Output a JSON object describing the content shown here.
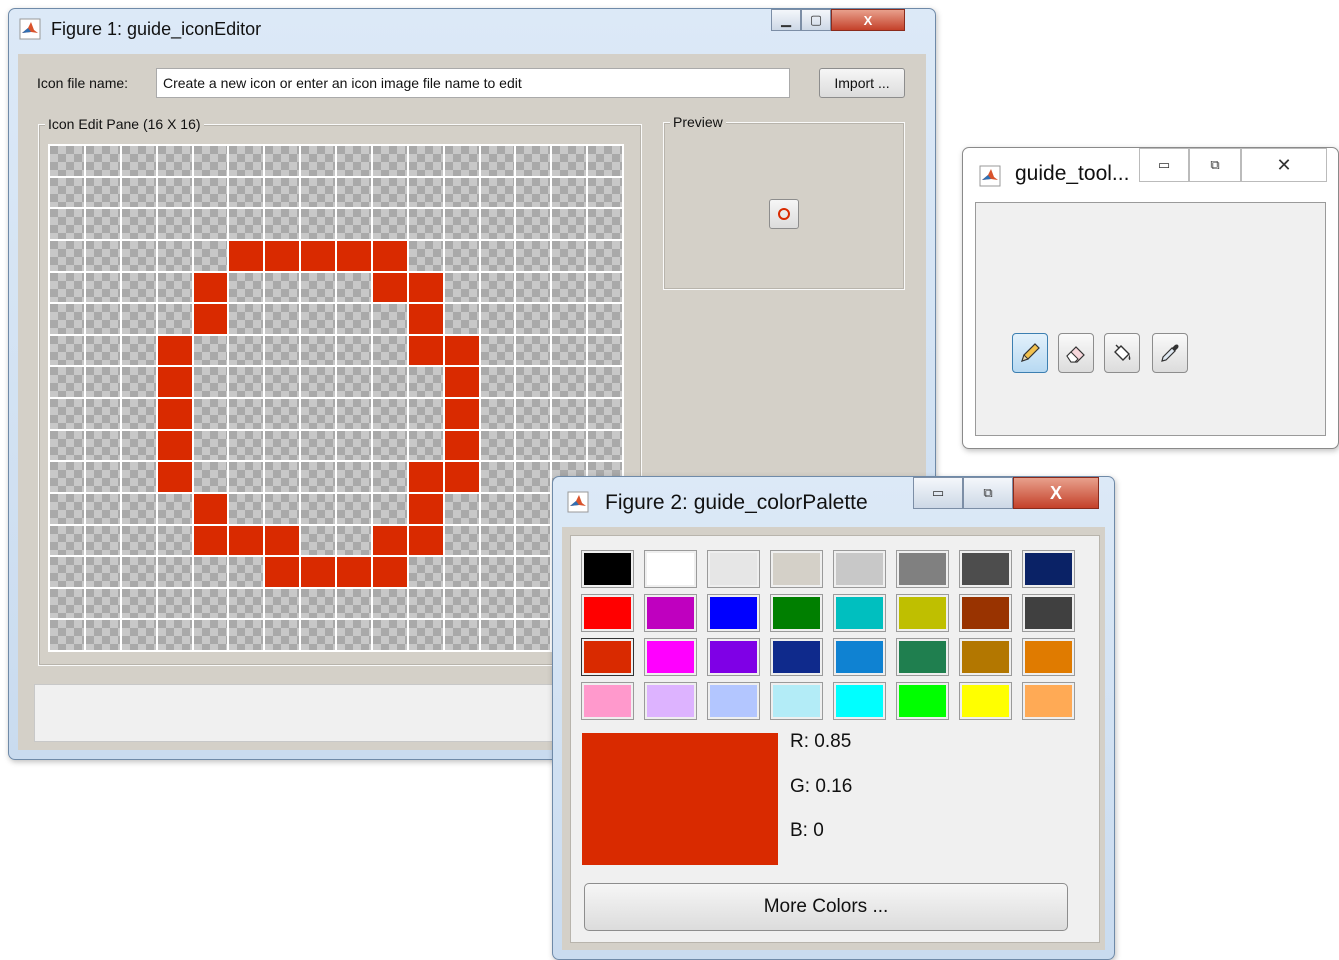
{
  "figure1": {
    "title": "Figure 1: guide_iconEditor",
    "icon_file_label": "Icon file name:",
    "icon_file_value": "Create a new icon or enter an icon image file name to edit",
    "import_label": "Import ...",
    "edit_pane_title": "Icon Edit Pane (16 X 16)",
    "preview_title": "Preview",
    "grid_size": 16,
    "paint_color": "#d92a00",
    "painted_cells": [
      [
        3,
        5
      ],
      [
        3,
        6
      ],
      [
        3,
        7
      ],
      [
        3,
        8
      ],
      [
        3,
        9
      ],
      [
        4,
        4
      ],
      [
        4,
        9
      ],
      [
        4,
        10
      ],
      [
        5,
        4
      ],
      [
        5,
        10
      ],
      [
        6,
        3
      ],
      [
        6,
        10
      ],
      [
        6,
        11
      ],
      [
        7,
        3
      ],
      [
        7,
        11
      ],
      [
        8,
        3
      ],
      [
        8,
        11
      ],
      [
        9,
        3
      ],
      [
        9,
        11
      ],
      [
        10,
        3
      ],
      [
        10,
        10
      ],
      [
        10,
        11
      ],
      [
        11,
        4
      ],
      [
        11,
        10
      ],
      [
        12,
        4
      ],
      [
        12,
        5
      ],
      [
        12,
        6
      ],
      [
        12,
        9
      ],
      [
        12,
        10
      ],
      [
        13,
        6
      ],
      [
        13,
        7
      ],
      [
        13,
        8
      ],
      [
        13,
        9
      ]
    ]
  },
  "toolbar": {
    "title": "guide_tool...",
    "tools": [
      "pencil-icon",
      "eraser-icon",
      "paint-bucket-icon",
      "eyedropper-icon"
    ]
  },
  "palette": {
    "title": "Figure 2: guide_colorPalette",
    "colors": [
      "#000000",
      "#ffffff",
      "#e6e6e6",
      "#d4d0c8",
      "#c8c8c8",
      "#808080",
      "#4d4d4d",
      "#0a2266",
      "#ff0000",
      "#bf00bf",
      "#0000ff",
      "#007f00",
      "#00bfbf",
      "#bfbf00",
      "#993300",
      "#404040",
      "#d92a00",
      "#ff00ff",
      "#7f00e6",
      "#0f2a8c",
      "#0f82d2",
      "#1f7f4f",
      "#b37700",
      "#e07b00",
      "#ff99cc",
      "#ddb3ff",
      "#b3c6ff",
      "#b3ecf7",
      "#00ffff",
      "#00ff00",
      "#ffff00",
      "#ffaa55"
    ],
    "selected_index": 16,
    "current_color": "#d92a00",
    "r_label": "R: 0.85",
    "g_label": "G: 0.16",
    "b_label": "B: 0",
    "more_colors_label": "More Colors ..."
  }
}
